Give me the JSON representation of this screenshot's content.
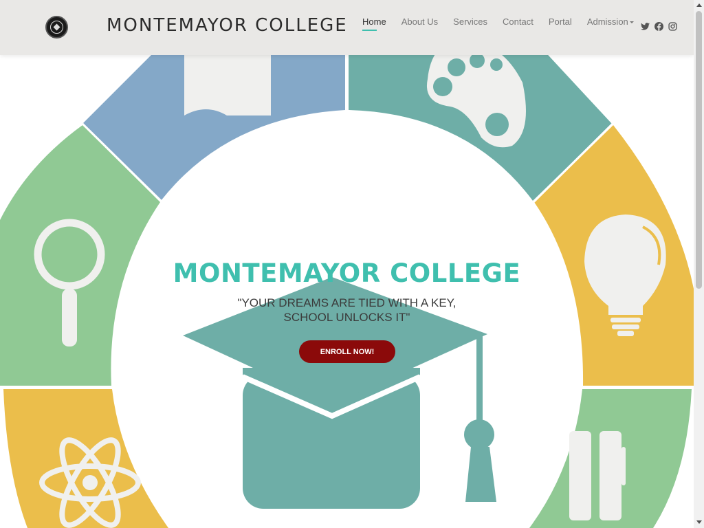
{
  "header": {
    "brand": "MONTEMAYOR COLLEGE",
    "nav": [
      {
        "label": "Home",
        "active": true
      },
      {
        "label": "About Us"
      },
      {
        "label": "Services"
      },
      {
        "label": "Contact"
      },
      {
        "label": "Portal"
      },
      {
        "label": "Admission",
        "dropdown": true
      }
    ],
    "socials": [
      "twitter-icon",
      "facebook-icon",
      "instagram-icon"
    ]
  },
  "hero": {
    "title": "MONTEMAYOR COLLEGE",
    "tagline_line1": "\"YOUR DREAMS ARE TIED WITH A KEY,",
    "tagline_line2": "SCHOOL UNLOCKS IT\"",
    "cta": "ENROLL NOW!"
  },
  "colors": {
    "accent": "#3fbfae",
    "cta": "#8b0a0a",
    "teal": "#6eaea7",
    "blue": "#84a8c8",
    "green": "#90c994",
    "yellow": "#ebbe4b",
    "header_bg": "#e9e8e6"
  }
}
